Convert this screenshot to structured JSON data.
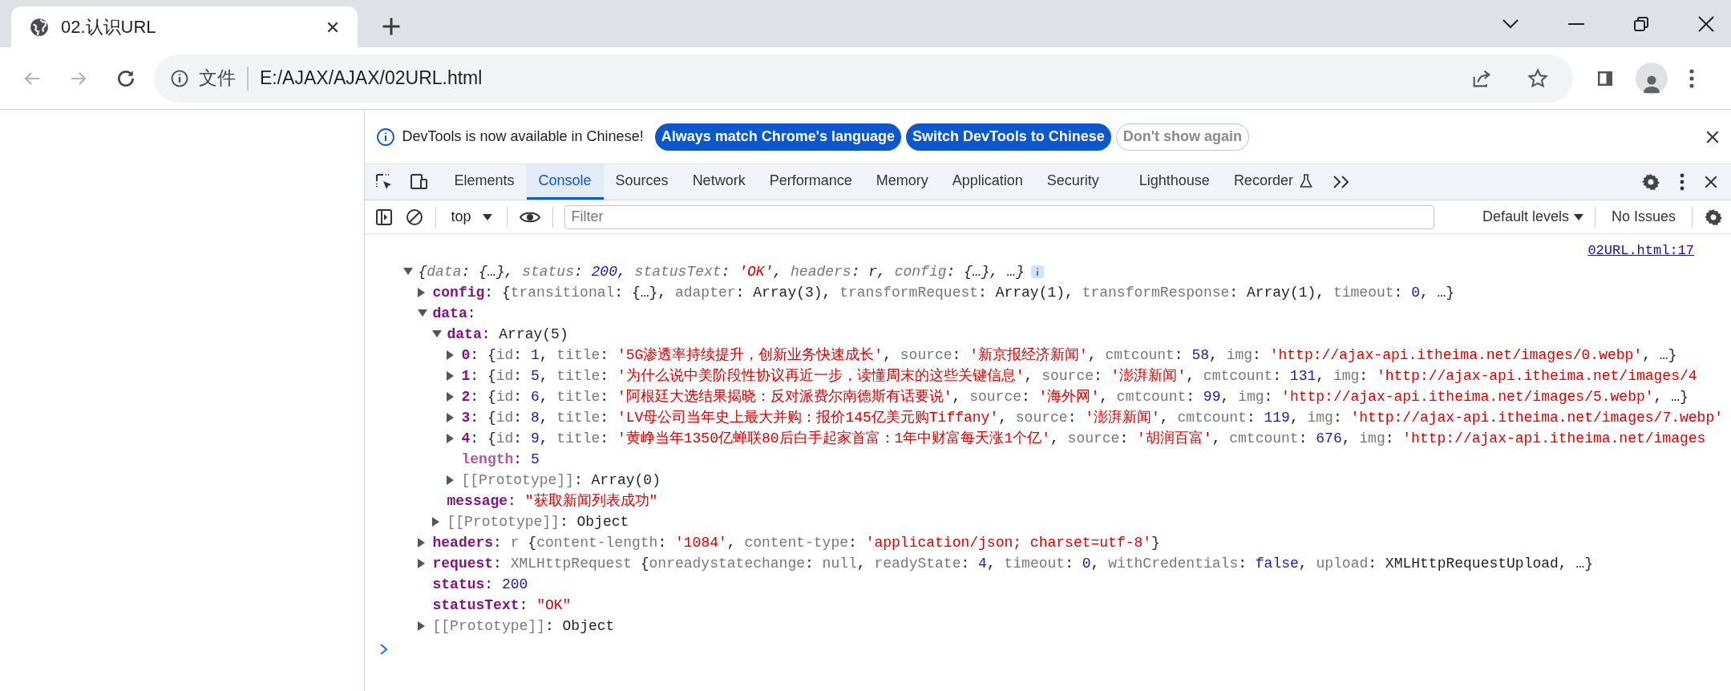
{
  "browser_tab": {
    "title": "02.认识URL",
    "selected": true
  },
  "address_bar": {
    "security_label": "文件",
    "url": "E:/AJAX/AJAX/02URL.html"
  },
  "devtools": {
    "banner": {
      "message": "DevTools is now available in Chinese!",
      "buttons": [
        {
          "label": "Always match Chrome's language",
          "kind": "primary"
        },
        {
          "label": "Switch DevTools to Chinese",
          "kind": "primary"
        },
        {
          "label": "Don't show again",
          "kind": "secondary"
        }
      ]
    },
    "tabs": [
      {
        "label": "Elements",
        "selected": false
      },
      {
        "label": "Console",
        "selected": true
      },
      {
        "label": "Sources",
        "selected": false
      },
      {
        "label": "Network",
        "selected": false
      },
      {
        "label": "Performance",
        "selected": false
      },
      {
        "label": "Memory",
        "selected": false
      },
      {
        "label": "Application",
        "selected": false
      },
      {
        "label": "Security",
        "selected": false
      },
      {
        "label": "Lighthouse",
        "selected": false
      },
      {
        "label": "Recorder",
        "selected": false
      }
    ],
    "console_toolbar": {
      "context": "top",
      "filter_placeholder": "Filter",
      "levels": "Default levels",
      "issues": "No Issues"
    },
    "console": {
      "source_link": "02URL.html:17",
      "tree": {
        "kind": "preview",
        "expanded": true,
        "segments": [
          {
            "kind": "plain",
            "text": "{"
          },
          {
            "kind": "name",
            "text": "data"
          },
          {
            "kind": "plain",
            "text": ": {…}, "
          },
          {
            "kind": "name",
            "text": "status"
          },
          {
            "kind": "plain",
            "text": ": "
          },
          {
            "kind": "num",
            "text": "200"
          },
          {
            "kind": "plain",
            "text": ", "
          },
          {
            "kind": "name",
            "text": "statusText"
          },
          {
            "kind": "plain",
            "text": ": "
          },
          {
            "kind": "str",
            "text": "'OK'"
          },
          {
            "kind": "plain",
            "text": ", "
          },
          {
            "kind": "name",
            "text": "headers"
          },
          {
            "kind": "plain",
            "text": ": r, "
          },
          {
            "kind": "name",
            "text": "config"
          },
          {
            "kind": "plain",
            "text": ": {…}, …}"
          }
        ],
        "children": [
          {
            "kind": "expandable",
            "expanded": false,
            "segments": [
              {
                "kind": "key",
                "text": "config"
              },
              {
                "kind": "plain",
                "text": ": {"
              },
              {
                "kind": "name",
                "text": "transitional"
              },
              {
                "kind": "plain",
                "text": ": {…}, "
              },
              {
                "kind": "name",
                "text": "adapter"
              },
              {
                "kind": "plain",
                "text": ": Array(3), "
              },
              {
                "kind": "name",
                "text": "transformRequest"
              },
              {
                "kind": "plain",
                "text": ": Array(1), "
              },
              {
                "kind": "name",
                "text": "transformResponse"
              },
              {
                "kind": "plain",
                "text": ": Array(1), "
              },
              {
                "kind": "name",
                "text": "timeout"
              },
              {
                "kind": "plain",
                "text": ": "
              },
              {
                "kind": "num",
                "text": "0"
              },
              {
                "kind": "plain",
                "text": ", …}"
              }
            ]
          },
          {
            "kind": "expandable",
            "expanded": true,
            "segments": [
              {
                "kind": "key",
                "text": "data"
              },
              {
                "kind": "plain",
                "text": ":"
              }
            ],
            "children": [
              {
                "kind": "expandable",
                "expanded": true,
                "segments": [
                  {
                    "kind": "key",
                    "text": "data"
                  },
                  {
                    "kind": "plain",
                    "text": ": Array(5)"
                  }
                ],
                "children": [
                  {
                    "kind": "expandable",
                    "expanded": false,
                    "segments": [
                      {
                        "kind": "key",
                        "text": "0"
                      },
                      {
                        "kind": "plain",
                        "text": ": {"
                      },
                      {
                        "kind": "name",
                        "text": "id"
                      },
                      {
                        "kind": "plain",
                        "text": ": "
                      },
                      {
                        "kind": "num",
                        "text": "1"
                      },
                      {
                        "kind": "plain",
                        "text": ", "
                      },
                      {
                        "kind": "name",
                        "text": "title"
                      },
                      {
                        "kind": "plain",
                        "text": ": "
                      },
                      {
                        "kind": "str",
                        "text": "'5G渗透率持续提升，创新业务快速成长'"
                      },
                      {
                        "kind": "plain",
                        "text": ", "
                      },
                      {
                        "kind": "name",
                        "text": "source"
                      },
                      {
                        "kind": "plain",
                        "text": ": "
                      },
                      {
                        "kind": "str",
                        "text": "'新京报经济新闻'"
                      },
                      {
                        "kind": "plain",
                        "text": ", "
                      },
                      {
                        "kind": "name",
                        "text": "cmtcount"
                      },
                      {
                        "kind": "plain",
                        "text": ": "
                      },
                      {
                        "kind": "num",
                        "text": "58"
                      },
                      {
                        "kind": "plain",
                        "text": ", "
                      },
                      {
                        "kind": "name",
                        "text": "img"
                      },
                      {
                        "kind": "plain",
                        "text": ": "
                      },
                      {
                        "kind": "str",
                        "text": "'http://ajax-api.itheima.net/images/0.webp'"
                      },
                      {
                        "kind": "plain",
                        "text": ", …}"
                      }
                    ]
                  },
                  {
                    "kind": "expandable",
                    "expanded": false,
                    "segments": [
                      {
                        "kind": "key",
                        "text": "1"
                      },
                      {
                        "kind": "plain",
                        "text": ": {"
                      },
                      {
                        "kind": "name",
                        "text": "id"
                      },
                      {
                        "kind": "plain",
                        "text": ": "
                      },
                      {
                        "kind": "num",
                        "text": "5"
                      },
                      {
                        "kind": "plain",
                        "text": ", "
                      },
                      {
                        "kind": "name",
                        "text": "title"
                      },
                      {
                        "kind": "plain",
                        "text": ": "
                      },
                      {
                        "kind": "str",
                        "text": "'为什么说中美阶段性协议再近一步，读懂周末的这些关键信息'"
                      },
                      {
                        "kind": "plain",
                        "text": ", "
                      },
                      {
                        "kind": "name",
                        "text": "source"
                      },
                      {
                        "kind": "plain",
                        "text": ": "
                      },
                      {
                        "kind": "str",
                        "text": "'澎湃新闻'"
                      },
                      {
                        "kind": "plain",
                        "text": ", "
                      },
                      {
                        "kind": "name",
                        "text": "cmtcount"
                      },
                      {
                        "kind": "plain",
                        "text": ": "
                      },
                      {
                        "kind": "num",
                        "text": "131"
                      },
                      {
                        "kind": "plain",
                        "text": ", "
                      },
                      {
                        "kind": "name",
                        "text": "img"
                      },
                      {
                        "kind": "plain",
                        "text": ": "
                      },
                      {
                        "kind": "str",
                        "text": "'http://ajax-api.itheima.net/images/4"
                      }
                    ]
                  },
                  {
                    "kind": "expandable",
                    "expanded": false,
                    "segments": [
                      {
                        "kind": "key",
                        "text": "2"
                      },
                      {
                        "kind": "plain",
                        "text": ": {"
                      },
                      {
                        "kind": "name",
                        "text": "id"
                      },
                      {
                        "kind": "plain",
                        "text": ": "
                      },
                      {
                        "kind": "num",
                        "text": "6"
                      },
                      {
                        "kind": "plain",
                        "text": ", "
                      },
                      {
                        "kind": "name",
                        "text": "title"
                      },
                      {
                        "kind": "plain",
                        "text": ": "
                      },
                      {
                        "kind": "str",
                        "text": "'阿根廷大选结果揭晓：反对派费尔南德斯有话要说'"
                      },
                      {
                        "kind": "plain",
                        "text": ", "
                      },
                      {
                        "kind": "name",
                        "text": "source"
                      },
                      {
                        "kind": "plain",
                        "text": ": "
                      },
                      {
                        "kind": "str",
                        "text": "'海外网'"
                      },
                      {
                        "kind": "plain",
                        "text": ", "
                      },
                      {
                        "kind": "name",
                        "text": "cmtcount"
                      },
                      {
                        "kind": "plain",
                        "text": ": "
                      },
                      {
                        "kind": "num",
                        "text": "99"
                      },
                      {
                        "kind": "plain",
                        "text": ", "
                      },
                      {
                        "kind": "name",
                        "text": "img"
                      },
                      {
                        "kind": "plain",
                        "text": ": "
                      },
                      {
                        "kind": "str",
                        "text": "'http://ajax-api.itheima.net/images/5.webp'"
                      },
                      {
                        "kind": "plain",
                        "text": ", …}"
                      }
                    ]
                  },
                  {
                    "kind": "expandable",
                    "expanded": false,
                    "segments": [
                      {
                        "kind": "key",
                        "text": "3"
                      },
                      {
                        "kind": "plain",
                        "text": ": {"
                      },
                      {
                        "kind": "name",
                        "text": "id"
                      },
                      {
                        "kind": "plain",
                        "text": ": "
                      },
                      {
                        "kind": "num",
                        "text": "8"
                      },
                      {
                        "kind": "plain",
                        "text": ", "
                      },
                      {
                        "kind": "name",
                        "text": "title"
                      },
                      {
                        "kind": "plain",
                        "text": ": "
                      },
                      {
                        "kind": "str",
                        "text": "'LV母公司当年史上最大并购：报价145亿美元购Tiffany'"
                      },
                      {
                        "kind": "plain",
                        "text": ", "
                      },
                      {
                        "kind": "name",
                        "text": "source"
                      },
                      {
                        "kind": "plain",
                        "text": ": "
                      },
                      {
                        "kind": "str",
                        "text": "'澎湃新闻'"
                      },
                      {
                        "kind": "plain",
                        "text": ", "
                      },
                      {
                        "kind": "name",
                        "text": "cmtcount"
                      },
                      {
                        "kind": "plain",
                        "text": ": "
                      },
                      {
                        "kind": "num",
                        "text": "119"
                      },
                      {
                        "kind": "plain",
                        "text": ", "
                      },
                      {
                        "kind": "name",
                        "text": "img"
                      },
                      {
                        "kind": "plain",
                        "text": ": "
                      },
                      {
                        "kind": "str",
                        "text": "'http://ajax-api.itheima.net/images/7.webp'"
                      }
                    ]
                  },
                  {
                    "kind": "expandable",
                    "expanded": false,
                    "segments": [
                      {
                        "kind": "key",
                        "text": "4"
                      },
                      {
                        "kind": "plain",
                        "text": ": {"
                      },
                      {
                        "kind": "name",
                        "text": "id"
                      },
                      {
                        "kind": "plain",
                        "text": ": "
                      },
                      {
                        "kind": "num",
                        "text": "9"
                      },
                      {
                        "kind": "plain",
                        "text": ", "
                      },
                      {
                        "kind": "name",
                        "text": "title"
                      },
                      {
                        "kind": "plain",
                        "text": ": "
                      },
                      {
                        "kind": "str",
                        "text": "'黄峥当年1350亿蝉联80后白手起家首富：1年中财富每天涨1个亿'"
                      },
                      {
                        "kind": "plain",
                        "text": ", "
                      },
                      {
                        "kind": "name",
                        "text": "source"
                      },
                      {
                        "kind": "plain",
                        "text": ": "
                      },
                      {
                        "kind": "str",
                        "text": "'胡润百富'"
                      },
                      {
                        "kind": "plain",
                        "text": ", "
                      },
                      {
                        "kind": "name",
                        "text": "cmtcount"
                      },
                      {
                        "kind": "plain",
                        "text": ": "
                      },
                      {
                        "kind": "num",
                        "text": "676"
                      },
                      {
                        "kind": "plain",
                        "text": ", "
                      },
                      {
                        "kind": "name",
                        "text": "img"
                      },
                      {
                        "kind": "plain",
                        "text": ": "
                      },
                      {
                        "kind": "str",
                        "text": "'http://ajax-api.itheima.net/images"
                      }
                    ]
                  },
                  {
                    "kind": "leaf",
                    "segments": [
                      {
                        "kind": "key_dim",
                        "text": "length"
                      },
                      {
                        "kind": "plain",
                        "text": ": "
                      },
                      {
                        "kind": "num",
                        "text": "5"
                      }
                    ]
                  },
                  {
                    "kind": "expandable",
                    "expanded": false,
                    "segments": [
                      {
                        "kind": "internal",
                        "text": "[[Prototype]]"
                      },
                      {
                        "kind": "plain",
                        "text": ": Array(0)"
                      }
                    ]
                  }
                ]
              },
              {
                "kind": "leaf",
                "segments": [
                  {
                    "kind": "key",
                    "text": "message"
                  },
                  {
                    "kind": "plain",
                    "text": ": "
                  },
                  {
                    "kind": "str",
                    "text": "\"获取新闻列表成功\""
                  }
                ]
              },
              {
                "kind": "expandable",
                "expanded": false,
                "segments": [
                  {
                    "kind": "internal",
                    "text": "[[Prototype]]"
                  },
                  {
                    "kind": "plain",
                    "text": ": Object"
                  }
                ]
              }
            ]
          },
          {
            "kind": "expandable",
            "expanded": false,
            "segments": [
              {
                "kind": "key",
                "text": "headers"
              },
              {
                "kind": "plain",
                "text": ": "
              },
              {
                "kind": "name",
                "text": "r"
              },
              {
                "kind": "plain",
                "text": " {"
              },
              {
                "kind": "name",
                "text": "content-length"
              },
              {
                "kind": "plain",
                "text": ": "
              },
              {
                "kind": "str",
                "text": "'1084'"
              },
              {
                "kind": "plain",
                "text": ", "
              },
              {
                "kind": "name",
                "text": "content-type"
              },
              {
                "kind": "plain",
                "text": ": "
              },
              {
                "kind": "str",
                "text": "'application/json; charset=utf-8'"
              },
              {
                "kind": "plain",
                "text": "}"
              }
            ]
          },
          {
            "kind": "expandable",
            "expanded": false,
            "segments": [
              {
                "kind": "key",
                "text": "request"
              },
              {
                "kind": "plain",
                "text": ": "
              },
              {
                "kind": "name",
                "text": "XMLHttpRequest"
              },
              {
                "kind": "plain",
                "text": " {"
              },
              {
                "kind": "name",
                "text": "onreadystatechange"
              },
              {
                "kind": "plain",
                "text": ": "
              },
              {
                "kind": "name",
                "text": "null"
              },
              {
                "kind": "plain",
                "text": ", "
              },
              {
                "kind": "name",
                "text": "readyState"
              },
              {
                "kind": "plain",
                "text": ": "
              },
              {
                "kind": "num",
                "text": "4"
              },
              {
                "kind": "plain",
                "text": ", "
              },
              {
                "kind": "name",
                "text": "timeout"
              },
              {
                "kind": "plain",
                "text": ": "
              },
              {
                "kind": "num",
                "text": "0"
              },
              {
                "kind": "plain",
                "text": ", "
              },
              {
                "kind": "name",
                "text": "withCredentials"
              },
              {
                "kind": "plain",
                "text": ": "
              },
              {
                "kind": "num",
                "text": "false"
              },
              {
                "kind": "plain",
                "text": ", "
              },
              {
                "kind": "name",
                "text": "upload"
              },
              {
                "kind": "plain",
                "text": ": XMLHttpRequestUpload, …}"
              }
            ]
          },
          {
            "kind": "leaf",
            "segments": [
              {
                "kind": "key",
                "text": "status"
              },
              {
                "kind": "plain",
                "text": ": "
              },
              {
                "kind": "num",
                "text": "200"
              }
            ]
          },
          {
            "kind": "leaf",
            "segments": [
              {
                "kind": "key",
                "text": "statusText"
              },
              {
                "kind": "plain",
                "text": ": "
              },
              {
                "kind": "str",
                "text": "\"OK\""
              }
            ]
          },
          {
            "kind": "expandable",
            "expanded": false,
            "segments": [
              {
                "kind": "internal",
                "text": "[[Prototype]]"
              },
              {
                "kind": "plain",
                "text": ": Object"
              }
            ]
          }
        ]
      }
    }
  }
}
